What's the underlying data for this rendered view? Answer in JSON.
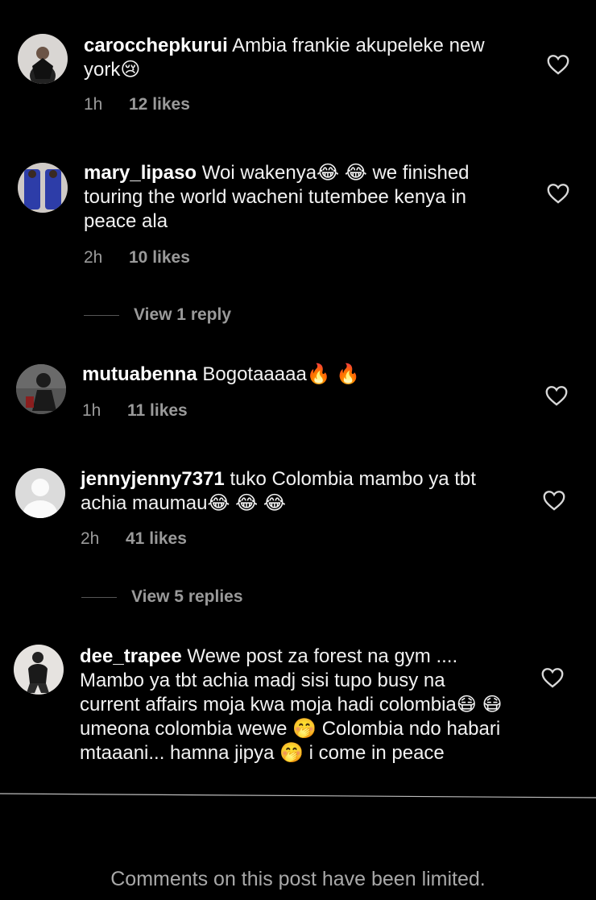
{
  "comments": [
    {
      "username": "carocchepkurui",
      "text": "Ambia frankie akupeleke new york😢",
      "time": "1h",
      "likes": "12 likes"
    },
    {
      "username": "mary_lipaso",
      "text": "Woi wakenya😂 😂 we finished touring the world wacheni tutembee kenya in peace ala",
      "time": "2h",
      "likes": "10 likes",
      "replies": "View 1 reply"
    },
    {
      "username": "mutuabenna",
      "text": "Bogotaaaaa🔥 🔥",
      "time": "1h",
      "likes": "11 likes"
    },
    {
      "username": "jennyjenny7371",
      "text": "tuko Colombia mambo ya tbt achia maumau😂 😂 😂",
      "time": "2h",
      "likes": "41 likes",
      "replies": "View 5 replies"
    },
    {
      "username": "dee_trapee",
      "text": "Wewe post za forest na gym .... Mambo ya tbt achia madj sisi tupo busy na current affairs moja kwa moja hadi colombia😷 😷 umeona colombia wewe 🤭 Colombia ndo habari mtaaani... hamna jipya 🤭 i come in peace"
    }
  ],
  "footer": {
    "limited_notice": "Comments on this post have been limited."
  }
}
